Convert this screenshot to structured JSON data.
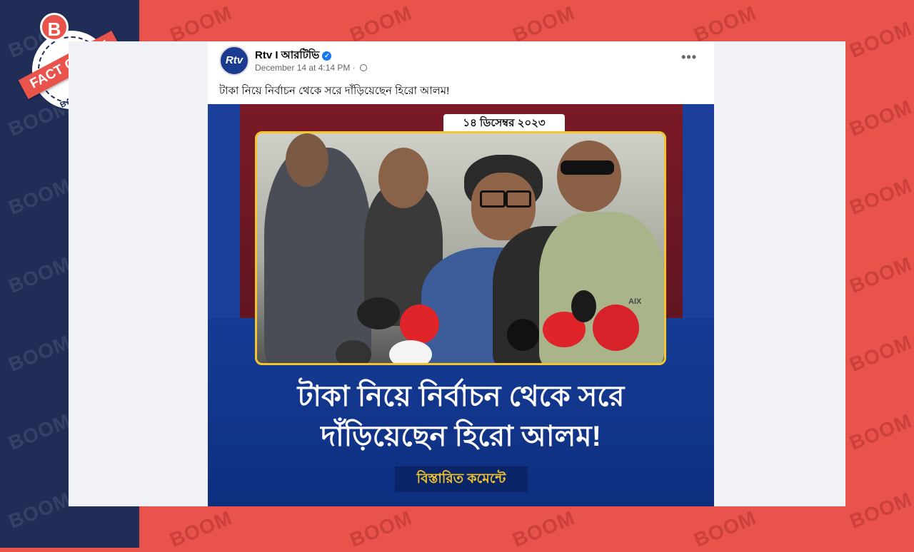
{
  "watermark": "BOOM",
  "badge": {
    "letter": "B",
    "ribbon": "FACT CHECK",
    "country": "BANGLADESH"
  },
  "post": {
    "page_name": "Rtv I আরটিভি",
    "avatar_text": "Rtv",
    "verified_icon": "verified-check-icon",
    "timestamp": "December 14 at 4:14 PM",
    "separator": "·",
    "privacy_icon": "globe-icon",
    "more_label": "•••",
    "caption": "টাকা নিয়ে নির্বাচন থেকে সরে দাঁড়িয়েছেন হিরো আলম!"
  },
  "image": {
    "date_tab": "১৪ ডিসেম্বর ২০২৩",
    "headline_line1": "টাকা নিয়ে নির্বাচন থেকে সরে",
    "headline_line2": "দাঁড়িয়েছেন হিরো আলম!",
    "details": "বিস্তারিত কমেন্টে",
    "shirt_text": "AIX"
  },
  "colors": {
    "navy": "#1f2d57",
    "boom_red": "#e8534b",
    "facebook_blue": "#1877f2",
    "image_blue": "#153c95",
    "accent_yellow": "#f3c52a"
  }
}
